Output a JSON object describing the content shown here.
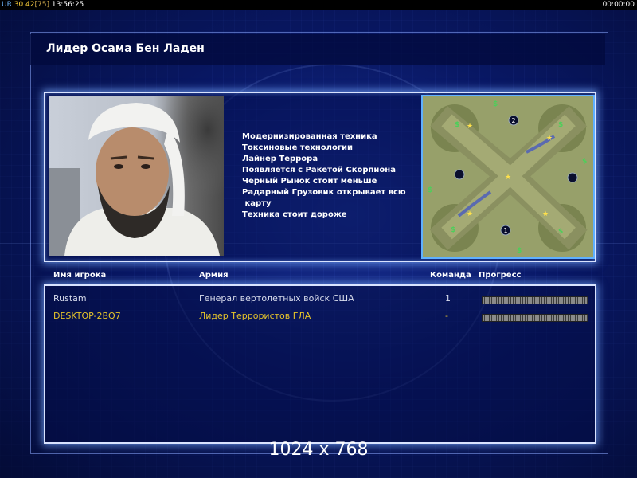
{
  "topbar": {
    "ur": "UR",
    "stat_a": "30",
    "stat_b": "42",
    "stat_c": "[75]",
    "clock": "13:56:25",
    "timer": "00:00:00"
  },
  "title": "Лидер Осама Бен Ладен",
  "features": [
    "Модернизированная техника",
    "Токсиновые технологии",
    "Лайнер Террора",
    "Появляется с Ракетой Скорпиона",
    "Черный Рынок стоит меньше",
    "Радарный Грузовик открывает всю",
    " карту",
    "Техника стоит дороже"
  ],
  "minimap": {
    "start_labels": [
      "2",
      "1"
    ]
  },
  "table": {
    "headers": {
      "player": "Имя игрока",
      "army": "Армия",
      "team": "Команда",
      "progress": "Прогресс"
    },
    "rows": [
      {
        "name": "Rustam",
        "army": "Генерал вертолетных войск США",
        "team": "1",
        "color": "#d8dcec"
      },
      {
        "name": "DESKTOP-2BQ7",
        "army": "Лидер Террористов ГЛА",
        "team": "-",
        "color": "#e6c42a"
      }
    ]
  },
  "resolution": "1024 x 768"
}
